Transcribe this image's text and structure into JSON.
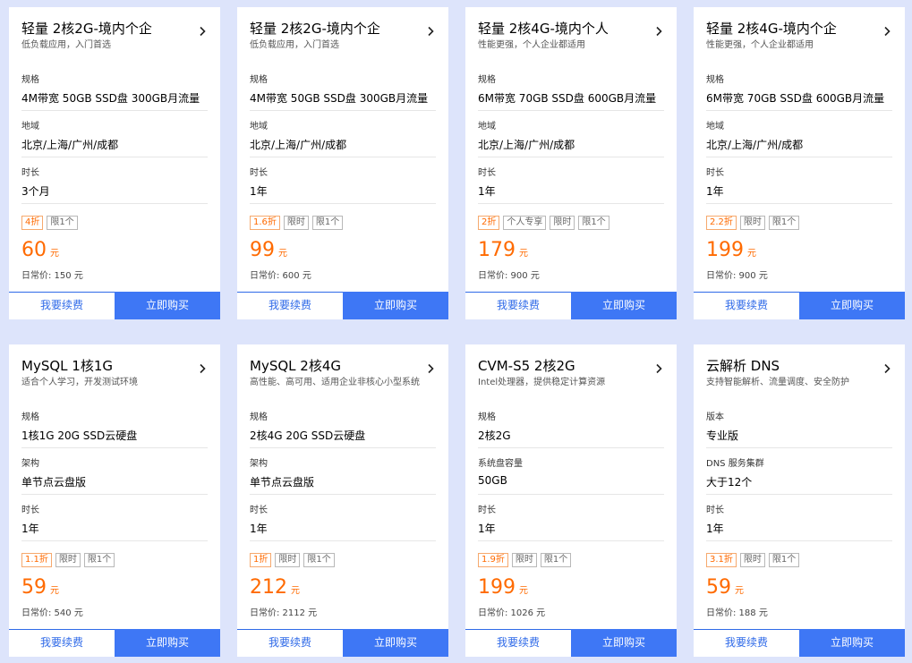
{
  "cards": [
    {
      "title": "轻量 2核2G-境内个企",
      "subtitle": "低负载应用，入门首选",
      "specs": [
        {
          "label": "规格",
          "value": "4M带宽 50GB SSD盘 300GB月流量"
        },
        {
          "label": "地域",
          "value": "北京/上海/广州/成都"
        },
        {
          "label": "时长",
          "value": "3个月"
        }
      ],
      "tags": [
        "4折",
        "限1个"
      ],
      "price": "60",
      "price_unit": "元",
      "original_price": "日常价: 150 元",
      "renew_label": "我要续费",
      "buy_label": "立即购买"
    },
    {
      "title": "轻量 2核2G-境内个企",
      "subtitle": "低负载应用，入门首选",
      "specs": [
        {
          "label": "规格",
          "value": "4M带宽 50GB SSD盘 300GB月流量"
        },
        {
          "label": "地域",
          "value": "北京/上海/广州/成都"
        },
        {
          "label": "时长",
          "value": "1年"
        }
      ],
      "tags": [
        "1.6折",
        "限时",
        "限1个"
      ],
      "price": "99",
      "price_unit": "元",
      "original_price": "日常价: 600 元",
      "renew_label": "我要续费",
      "buy_label": "立即购买"
    },
    {
      "title": "轻量 2核4G-境内个人",
      "subtitle": "性能更强，个人企业都适用",
      "specs": [
        {
          "label": "规格",
          "value": "6M带宽 70GB SSD盘 600GB月流量"
        },
        {
          "label": "地域",
          "value": "北京/上海/广州/成都"
        },
        {
          "label": "时长",
          "value": "1年"
        }
      ],
      "tags": [
        "2折",
        "个人专享",
        "限时",
        "限1个"
      ],
      "price": "179",
      "price_unit": "元",
      "original_price": "日常价: 900 元",
      "renew_label": "我要续费",
      "buy_label": "立即购买"
    },
    {
      "title": "轻量 2核4G-境内个企",
      "subtitle": "性能更强，个人企业都适用",
      "specs": [
        {
          "label": "规格",
          "value": "6M带宽 70GB SSD盘 600GB月流量"
        },
        {
          "label": "地域",
          "value": "北京/上海/广州/成都"
        },
        {
          "label": "时长",
          "value": "1年"
        }
      ],
      "tags": [
        "2.2折",
        "限时",
        "限1个"
      ],
      "price": "199",
      "price_unit": "元",
      "original_price": "日常价: 900 元",
      "renew_label": "我要续费",
      "buy_label": "立即购买"
    },
    {
      "title": "MySQL 1核1G",
      "subtitle": "适合个人学习，开发测试环境",
      "specs": [
        {
          "label": "规格",
          "value": "1核1G 20G SSD云硬盘"
        },
        {
          "label": "架构",
          "value": "单节点云盘版"
        },
        {
          "label": "时长",
          "value": "1年"
        }
      ],
      "tags": [
        "1.1折",
        "限时",
        "限1个"
      ],
      "price": "59",
      "price_unit": "元",
      "original_price": "日常价: 540 元",
      "renew_label": "我要续费",
      "buy_label": "立即购买"
    },
    {
      "title": "MySQL 2核4G",
      "subtitle": "高性能、高可用、适用企业非核心小型系统",
      "specs": [
        {
          "label": "规格",
          "value": "2核4G 20G SSD云硬盘"
        },
        {
          "label": "架构",
          "value": "单节点云盘版"
        },
        {
          "label": "时长",
          "value": "1年"
        }
      ],
      "tags": [
        "1折",
        "限时",
        "限1个"
      ],
      "price": "212",
      "price_unit": "元",
      "original_price": "日常价: 2112 元",
      "renew_label": "我要续费",
      "buy_label": "立即购买"
    },
    {
      "title": "CVM-S5 2核2G",
      "subtitle": "Intel处理器，提供稳定计算资源",
      "specs": [
        {
          "label": "规格",
          "value": "2核2G"
        },
        {
          "label": "系统盘容量",
          "value": "50GB"
        },
        {
          "label": "时长",
          "value": "1年"
        }
      ],
      "tags": [
        "1.9折",
        "限时",
        "限1个"
      ],
      "price": "199",
      "price_unit": "元",
      "original_price": "日常价: 1026 元",
      "renew_label": "我要续费",
      "buy_label": "立即购买"
    },
    {
      "title": "云解析 DNS",
      "subtitle": "支持智能解析、流量调度、安全防护",
      "specs": [
        {
          "label": "版本",
          "value": "专业版"
        },
        {
          "label": "DNS 服务集群",
          "value": "大于12个"
        },
        {
          "label": "时长",
          "value": "1年"
        }
      ],
      "tags": [
        "3.1折",
        "限时",
        "限1个"
      ],
      "price": "59",
      "price_unit": "元",
      "original_price": "日常价: 188 元",
      "renew_label": "我要续费",
      "buy_label": "立即购买"
    }
  ],
  "colors": {
    "page_background": "#dde4fb",
    "price": "#ff6a00",
    "buy_button": "#3e77f5",
    "renew_text": "#2f6ae8"
  },
  "icons": {
    "card_link": "chevron-right-icon"
  }
}
